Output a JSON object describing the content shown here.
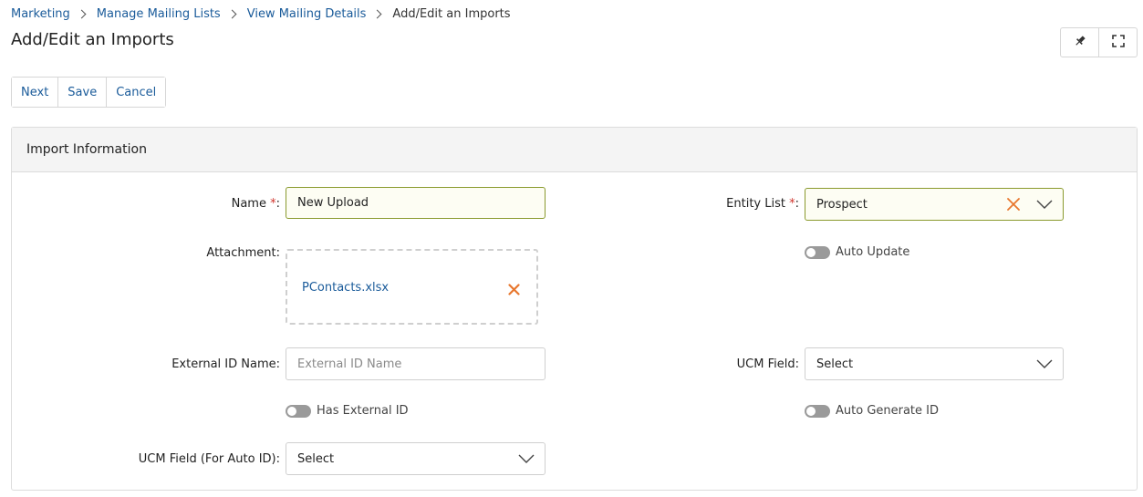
{
  "breadcrumb": {
    "items": [
      "Marketing",
      "Manage Mailing Lists",
      "View Mailing Details"
    ],
    "current": "Add/Edit an Imports"
  },
  "page": {
    "title": "Add/Edit an Imports"
  },
  "top_actions": {
    "icons": [
      "pin-icon",
      "fullscreen-icon"
    ]
  },
  "toolbar": {
    "next_label": "Next",
    "save_label": "Save",
    "cancel_label": "Cancel"
  },
  "panel": {
    "title": "Import Information"
  },
  "form": {
    "name": {
      "label": "Name",
      "required_mark": "*",
      "suffix": ":",
      "value": "New Upload"
    },
    "attachment": {
      "label": "Attachment:",
      "file_name": "PContacts.xlsx"
    },
    "external_id_name": {
      "label": "External ID Name:",
      "placeholder": "External ID Name"
    },
    "has_external_id": {
      "label": "Has External ID",
      "on": false
    },
    "ucm_field_auto_id": {
      "label": "UCM Field (For Auto ID):",
      "value": "Select"
    },
    "entity_list": {
      "label": "Entity List",
      "required_mark": "*",
      "suffix": ":",
      "value": "Prospect"
    },
    "auto_update": {
      "label": "Auto Update",
      "on": false
    },
    "ucm_field": {
      "label": "UCM Field:",
      "value": "Select"
    },
    "auto_generate_id": {
      "label": "Auto Generate ID",
      "on": false
    }
  },
  "colors": {
    "link": "#1a5b9a",
    "required": "#d0342c",
    "clear_icon": "#e8772e",
    "filled_border": "#8a9a2e"
  }
}
